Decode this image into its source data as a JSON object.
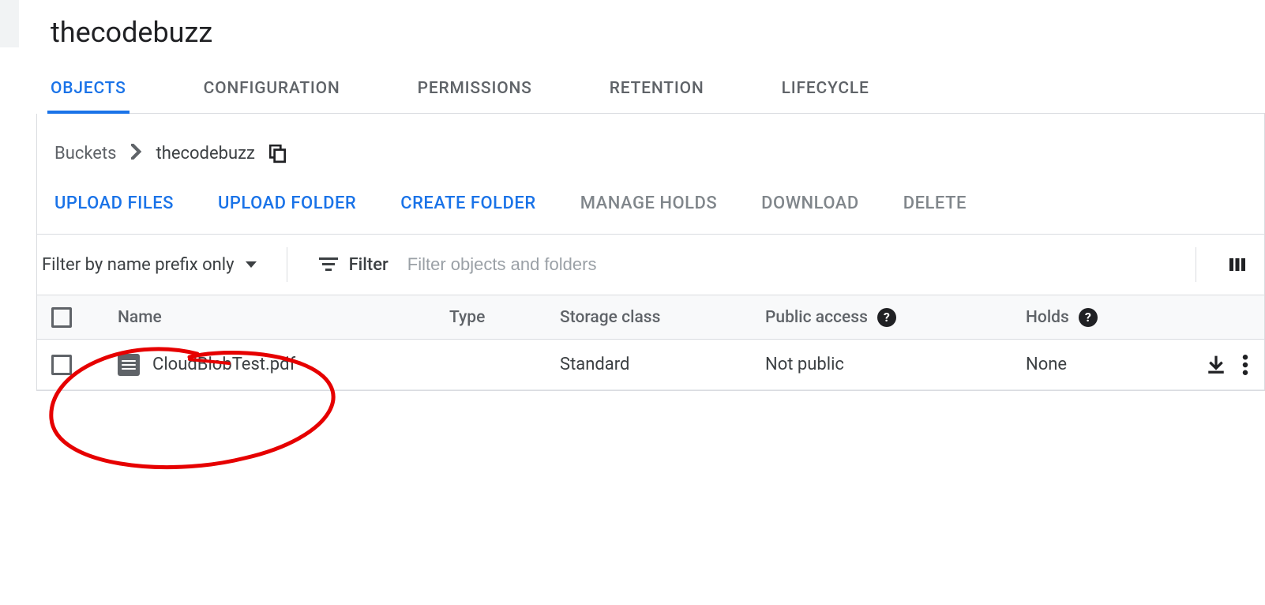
{
  "header": {
    "title": "thecodebuzz"
  },
  "tabs": [
    {
      "label": "OBJECTS",
      "active": true
    },
    {
      "label": "CONFIGURATION",
      "active": false
    },
    {
      "label": "PERMISSIONS",
      "active": false
    },
    {
      "label": "RETENTION",
      "active": false
    },
    {
      "label": "LIFECYCLE",
      "active": false
    }
  ],
  "breadcrumb": {
    "root": "Buckets",
    "current": "thecodebuzz"
  },
  "actions": {
    "upload_files": "UPLOAD FILES",
    "upload_folder": "UPLOAD FOLDER",
    "create_folder": "CREATE FOLDER",
    "manage_holds": "MANAGE HOLDS",
    "download": "DOWNLOAD",
    "delete": "DELETE"
  },
  "filter": {
    "prefix_label": "Filter by name prefix only",
    "filter_label": "Filter",
    "placeholder": "Filter objects and folders"
  },
  "columns": {
    "name": "Name",
    "type": "Type",
    "storage_class": "Storage class",
    "public_access": "Public access",
    "holds": "Holds"
  },
  "rows": [
    {
      "name": "CloudBlobTest.pdf",
      "type": "",
      "storage_class": "Standard",
      "public_access": "Not public",
      "holds": "None"
    }
  ]
}
